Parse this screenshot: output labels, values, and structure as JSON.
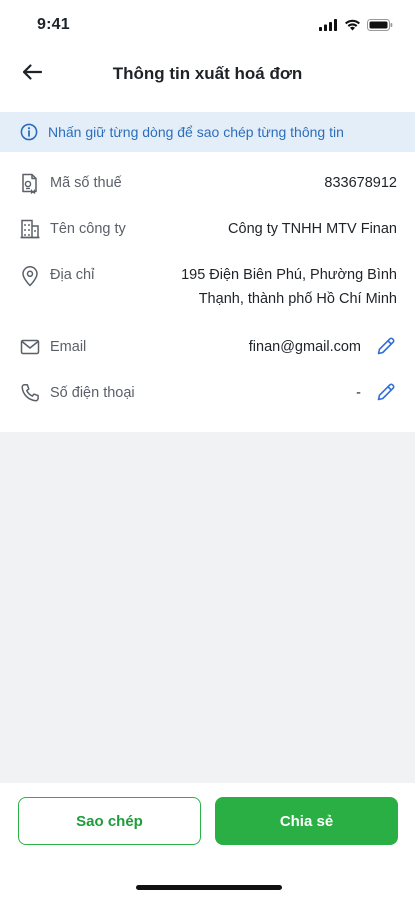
{
  "status_bar": {
    "time": "9:41"
  },
  "header": {
    "title": "Thông tin xuất hoá đơn"
  },
  "banner": {
    "text": "Nhấn giữ từng dòng để sao chép từng thông tin"
  },
  "fields": [
    {
      "label": "Mã số thuế",
      "value": "833678912",
      "icon": "tax-document-icon"
    },
    {
      "label": "Tên công ty",
      "value": "Công ty TNHH MTV Finan",
      "icon": "building-icon"
    },
    {
      "label": "Địa chỉ",
      "value_line1": "195 Điện Biên Phú, Phường Bình",
      "value_line2": "Thạnh, thành phố Hồ Chí Minh",
      "icon": "location-pin-icon"
    },
    {
      "label": "Email",
      "value": "finan@gmail.com",
      "icon": "mail-icon",
      "editable": true
    },
    {
      "label": "Số điện thoại",
      "value": "-",
      "icon": "phone-icon",
      "editable": true
    }
  ],
  "actions": {
    "copy_label": "Sao chép",
    "share_label": "Chia sẻ"
  },
  "colors": {
    "accent_green": "#2aaf45",
    "info_blue": "#2d6ebb",
    "banner_bg": "#e4eef9",
    "edit_blue": "#2f6fd6"
  }
}
